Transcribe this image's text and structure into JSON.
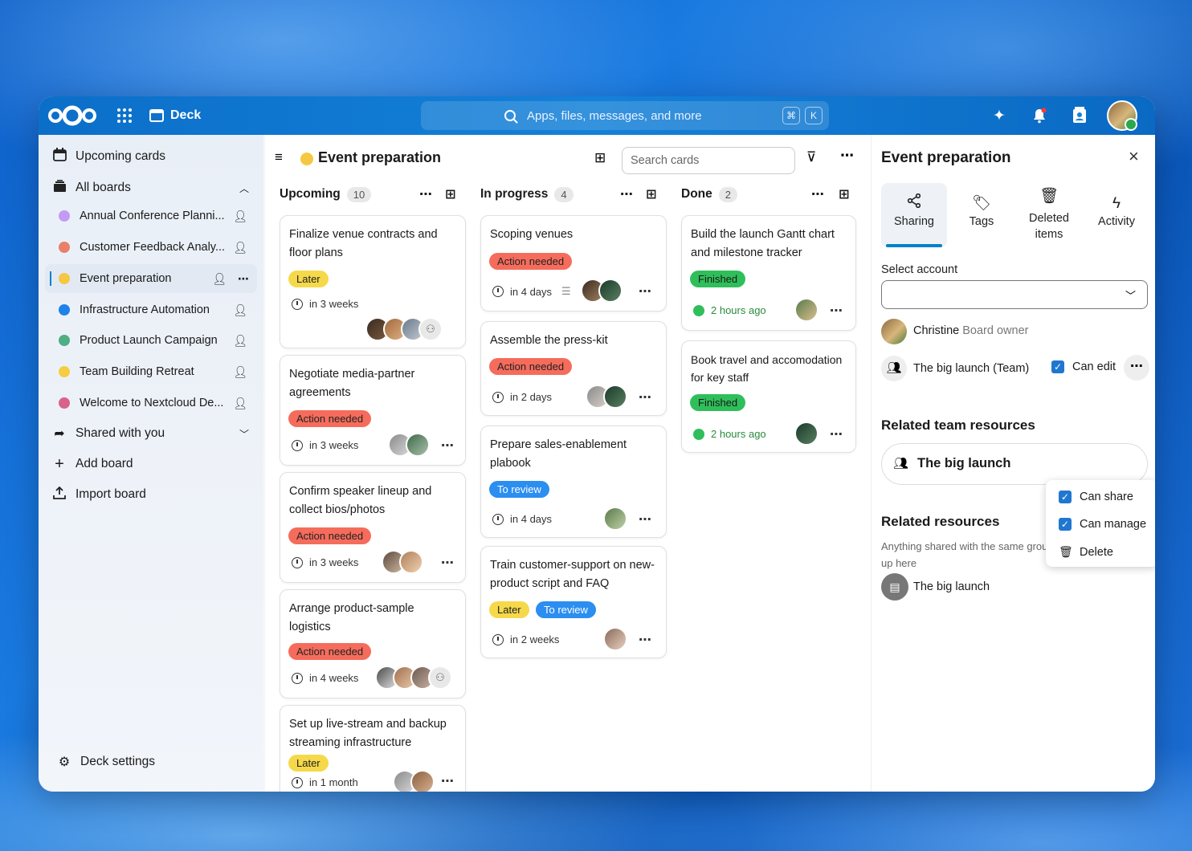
{
  "topbar": {
    "app_name": "Deck",
    "search_placeholder": "Apps, files, messages, and more",
    "kbd1": "⌘",
    "kbd2": "K"
  },
  "nav": {
    "upcoming": "Upcoming cards",
    "all_boards": "All boards",
    "boards": [
      {
        "name": "Annual Conference Planni...",
        "color": "#c39af5"
      },
      {
        "name": "Customer Feedback Analy...",
        "color": "#e8806a"
      },
      {
        "name": "Event preparation",
        "color": "#f5c842"
      },
      {
        "name": "Infrastructure Automation",
        "color": "#1e82e8"
      },
      {
        "name": "Product Launch Campaign",
        "color": "#4fae84"
      },
      {
        "name": "Team Building Retreat",
        "color": "#f5cd42"
      },
      {
        "name": "Welcome to Nextcloud De...",
        "color": "#d9628a"
      }
    ],
    "shared": "Shared with you",
    "add_board": "Add board",
    "import_board": "Import board",
    "settings": "Deck settings"
  },
  "board": {
    "title": "Event preparation",
    "color": "#f5c842",
    "search_placeholder": "Search cards"
  },
  "columns": [
    {
      "name": "Upcoming",
      "count": "10",
      "cards": [
        {
          "title": "Finalize venue contracts and floor plans",
          "tags": [
            {
              "label": "Later",
              "type": "later"
            }
          ],
          "due": "in 3 weeks"
        },
        {
          "title": "Negotiate media-partner agreements",
          "tags": [
            {
              "label": "Action needed",
              "type": "action"
            }
          ],
          "due": "in 3 weeks"
        },
        {
          "title": "Confirm speaker lineup and collect bios/photos",
          "tags": [
            {
              "label": "Action needed",
              "type": "action"
            }
          ],
          "due": "in 3 weeks"
        },
        {
          "title": "Arrange product-sample logistics",
          "tags": [
            {
              "label": "Action needed",
              "type": "action"
            }
          ],
          "due": "in 4 weeks"
        },
        {
          "title": "Set up live-stream and backup streaming infrastructure",
          "tags": [
            {
              "label": "Later",
              "type": "later"
            }
          ],
          "due": "in 1 month"
        }
      ]
    },
    {
      "name": "In progress",
      "count": "4",
      "cards": [
        {
          "title": "Scoping venues",
          "tags": [
            {
              "label": "Action needed",
              "type": "action"
            }
          ],
          "due": "in 4 days"
        },
        {
          "title": "Assemble the press-kit",
          "tags": [
            {
              "label": "Action needed",
              "type": "action"
            }
          ],
          "due": "in 2 days"
        },
        {
          "title": "Prepare sales-enablement plabook",
          "tags": [
            {
              "label": "To review",
              "type": "review"
            }
          ],
          "due": "in 4 days"
        },
        {
          "title": "Train customer-support on new-product script and FAQ",
          "tags": [
            {
              "label": "Later",
              "type": "later"
            },
            {
              "label": "To review",
              "type": "review"
            }
          ],
          "due": "in 2 weeks"
        }
      ]
    },
    {
      "name": "Done",
      "count": "2",
      "cards": [
        {
          "title": "Build the launch Gantt chart and milestone tracker",
          "tags": [
            {
              "label": "Finished",
              "type": "finished"
            }
          ],
          "due": "2 hours ago"
        },
        {
          "title": "Book travel and accomodation for key staff",
          "tags": [
            {
              "label": "Finished",
              "type": "finished"
            }
          ],
          "due": "2 hours ago"
        }
      ]
    }
  ],
  "sidebar": {
    "title": "Event preparation",
    "tabs": [
      {
        "label": "Sharing"
      },
      {
        "label": "Tags"
      },
      {
        "label": "Deleted items"
      },
      {
        "label": "Activity"
      }
    ],
    "select_account": "Select account",
    "owner_name": "Christine",
    "owner_role": "Board owner",
    "team_name": "The big launch (Team)",
    "can_edit": "Can edit",
    "menu": {
      "can_share": "Can share",
      "can_manage": "Can manage",
      "delete": "Delete"
    },
    "related_team_title": "Related team resources",
    "related_team_item": "The big launch",
    "related_title": "Related resources",
    "related_desc": "Anything shared with the same group of people will show up here",
    "related_item": "The big launch"
  }
}
